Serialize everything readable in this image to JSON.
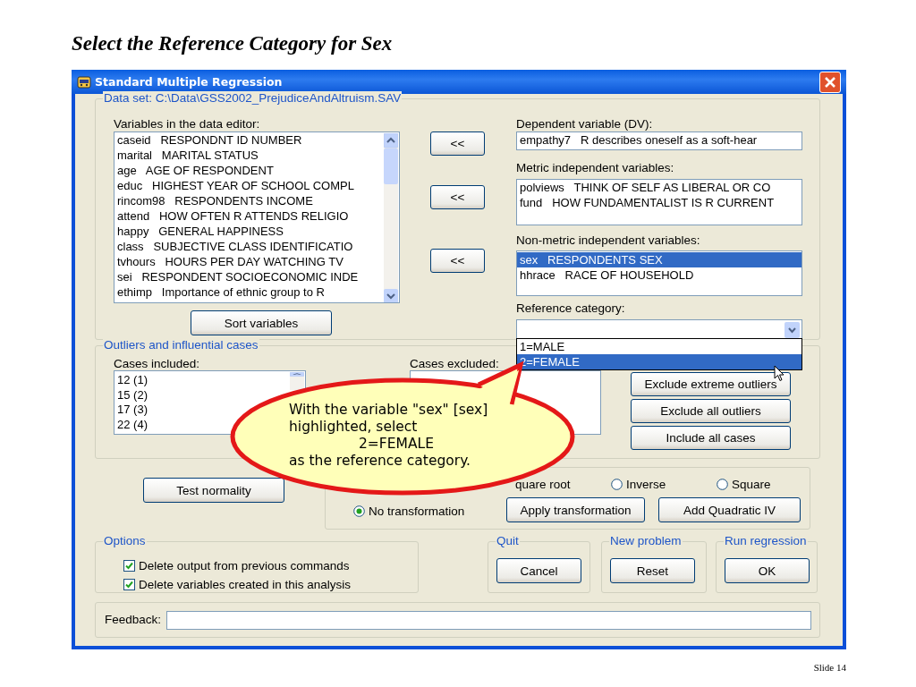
{
  "slide": {
    "title": "Select the Reference Category for Sex",
    "footer": "Slide 14"
  },
  "window": {
    "title": "Standard Multiple Regression"
  },
  "dataset": {
    "legend": "Data set: C:\\Data\\GSS2002_PrejudiceAndAltruism.SAV",
    "variables_label": "Variables in the data editor:",
    "variables": [
      "caseid   RESPONDNT ID NUMBER",
      "marital   MARITAL STATUS",
      "age   AGE OF RESPONDENT",
      "educ   HIGHEST YEAR OF SCHOOL COMPL",
      "rincom98   RESPONDENTS INCOME",
      "attend   HOW OFTEN R ATTENDS RELIGIO",
      "happy   GENERAL HAPPINESS",
      "class   SUBJECTIVE CLASS IDENTIFICATIO",
      "tvhours   HOURS PER DAY WATCHING TV",
      "sei   RESPONDENT SOCIOECONOMIC INDE",
      "ethimp   Importance of ethnic group to R"
    ],
    "sort_button": "Sort variables",
    "move_buttons": [
      "<<",
      "<<",
      "<<"
    ],
    "dv_label": "Dependent variable (DV):",
    "dv_value": "empathy7   R describes oneself as a soft-hear",
    "metric_label": "Metric independent variables:",
    "metric": [
      "polviews   THINK OF SELF AS LIBERAL OR CO",
      "fund   HOW FUNDAMENTALIST IS R CURRENT"
    ],
    "nonmetric_label": "Non-metric independent variables:",
    "nonmetric": [
      {
        "text": "sex   RESPONDENTS SEX",
        "selected": true
      },
      {
        "text": "hhrace   RACE OF HOUSEHOLD",
        "selected": false
      }
    ],
    "reference_label": "Reference category:",
    "reference_options": [
      {
        "label": "1=MALE",
        "selected": false
      },
      {
        "label": "2=FEMALE",
        "selected": true
      }
    ]
  },
  "outliers": {
    "legend": "Outliers and influential cases",
    "included_label": "Cases included:",
    "included": [
      "12 (1)",
      "15 (2)",
      "17 (3)",
      "22 (4)"
    ],
    "excluded_label": "Cases excluded:",
    "buttons": [
      "Exclude extreme outliers",
      "Exclude all outliers",
      "Include all cases"
    ]
  },
  "transformation": {
    "test_button": "Test normality",
    "options": [
      {
        "label": "quare root"
      },
      {
        "label": "Inverse",
        "selected": false
      },
      {
        "label": "Square",
        "selected": false
      },
      {
        "label": "No transformation",
        "selected": true
      }
    ],
    "buttons": [
      "Apply transformation",
      "Add Quadratic IV"
    ]
  },
  "options": {
    "legend": "Options",
    "checkboxes": [
      {
        "label": "Delete output from previous commands",
        "checked": true
      },
      {
        "label": "Delete variables created in this analysis",
        "checked": true
      }
    ]
  },
  "quit": {
    "legend": "Quit",
    "button": "Cancel"
  },
  "new_problem": {
    "legend": "New problem",
    "button": "Reset"
  },
  "run_regression": {
    "legend": "Run regression",
    "button": "OK"
  },
  "feedback": {
    "label": "Feedback:"
  },
  "callout": {
    "lines": [
      {
        "text": "With the variable \"sex\" [sex]",
        "indent": false
      },
      {
        "text": "highlighted, select",
        "indent": false
      },
      {
        "text": "2=FEMALE",
        "indent": true
      },
      {
        "text": "as the reference category.",
        "indent": false
      }
    ]
  }
}
